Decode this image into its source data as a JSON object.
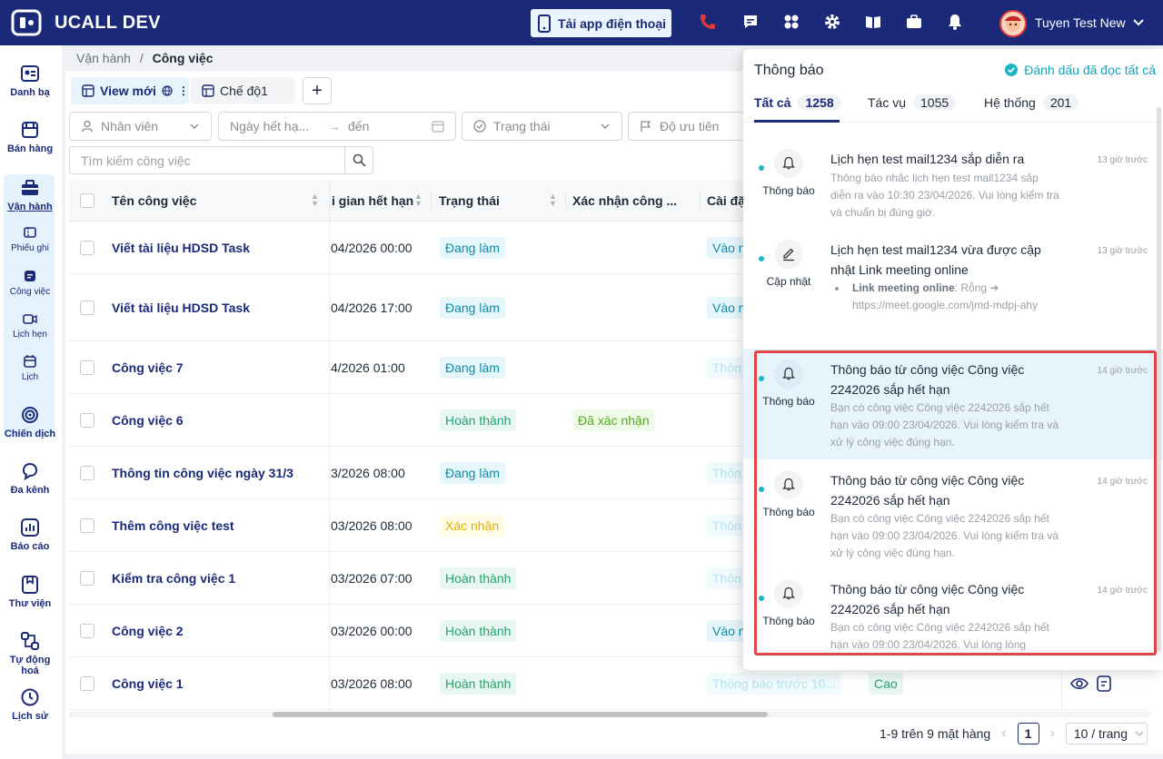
{
  "topbar": {
    "brand": "UCALL DEV",
    "app_button_label": "Tải app điện thoại",
    "user_name": "Tuyen Test New",
    "icons": [
      "phone-icon",
      "chat-icon",
      "apps-icon",
      "gear-icon",
      "book-icon",
      "briefcase-icon",
      "bell-icon"
    ]
  },
  "sidebar": {
    "items": [
      {
        "label": "Danh bạ",
        "icon": "contacts-icon"
      },
      {
        "label": "Bán hàng",
        "icon": "store-icon"
      },
      {
        "label": "Vận hành",
        "icon": "briefcase-icon"
      },
      {
        "label": "Phiếu ghi",
        "icon": "ticket-icon"
      },
      {
        "label": "Công việc",
        "icon": "task-icon"
      },
      {
        "label": "Lịch hẹn",
        "icon": "video-icon"
      },
      {
        "label": "Lịch",
        "icon": "calendar-icon"
      },
      {
        "label": "Chiến dịch",
        "icon": "target-icon"
      },
      {
        "label": "Đa kênh",
        "icon": "omnichannel-icon"
      },
      {
        "label": "Báo cáo",
        "icon": "chart-icon"
      },
      {
        "label": "Thư viện",
        "icon": "library-icon"
      },
      {
        "label": "Tự động hoá",
        "icon": "automation-icon"
      },
      {
        "label": "Lịch sử",
        "icon": "history-icon"
      }
    ]
  },
  "breadcrumb": {
    "parent": "Vận hành",
    "separator": "/",
    "current": "Công việc"
  },
  "views": {
    "view1": "View mới",
    "view2": "Chế độ1",
    "add": "+"
  },
  "filters": {
    "employee": "Nhân viên",
    "due_from": "Ngày hết hạ...",
    "arrow": "→",
    "due_to": "đến",
    "status": "Trạng thái",
    "priority": "Độ ưu tiên"
  },
  "search": {
    "placeholder": "Tìm kiếm công việc"
  },
  "table": {
    "columns": {
      "name": "Tên công việc",
      "due": "i gian hết hạn",
      "status": "Trạng thái",
      "confirm": "Xác nhận công ...",
      "setting": "Cài đặ"
    },
    "rows": [
      {
        "name": "Viết tài liệu HDSD Task",
        "due": "04/2026 00:00",
        "status": "Đang làm",
        "confirm": "",
        "remind": "Vào n"
      },
      {
        "name": "Viết tài liệu HDSD Task",
        "due": "04/2026 17:00",
        "status": "Đang làm",
        "confirm": "",
        "remind": "Vào n"
      },
      {
        "name": "Công việc 7",
        "due": "4/2026 01:00",
        "status": "Đang làm",
        "confirm": "",
        "remind": "Thôn"
      },
      {
        "name": "Công việc 6",
        "due": "",
        "status": "Hoàn thành",
        "confirm": "Đã xác nhận",
        "remind": ""
      },
      {
        "name": "Thông tin công việc ngày 31/3",
        "due": "3/2026 08:00",
        "status": "Đang làm",
        "confirm": "",
        "remind": "Thôn"
      },
      {
        "name": "Thêm công việc test",
        "due": "03/2026 08:00",
        "status": "Xác nhận",
        "confirm": "",
        "remind": "Thôn"
      },
      {
        "name": "Kiểm tra công việc 1",
        "due": "03/2026 07:00",
        "status": "Hoàn thành",
        "confirm": "",
        "remind": "Thôn"
      },
      {
        "name": "Công việc 2",
        "due": "03/2026 00:00",
        "status": "Hoàn thành",
        "confirm": "",
        "remind": "Vào n"
      },
      {
        "name": "Công việc 1",
        "due": "03/2026 08:00",
        "status": "Hoàn thành",
        "confirm": "",
        "remind": "Thông báo trước 10...",
        "priority": "Cao"
      }
    ]
  },
  "pagination": {
    "summary": "1-9 trên 9 mặt hàng",
    "prev": "‹",
    "page": "1",
    "next": "›",
    "page_size": "10 / trang"
  },
  "notifications": {
    "title": "Thông báo",
    "mark_all": "Đánh dấu đã đọc tất cả",
    "tabs": [
      {
        "label": "Tất cả",
        "count": "1258"
      },
      {
        "label": "Tác vụ",
        "count": "1055"
      },
      {
        "label": "Hệ thống",
        "count": "201"
      }
    ],
    "items": [
      {
        "type": "Thông báo",
        "icon": "bell-icon",
        "title": "Lịch hẹn test mail1234 sắp diễn ra",
        "body": "Thông báo nhắc lịch hẹn test mail1234 sắp diễn ra vào 10:30 23/04/2026. Vui lòng kiểm tra và chuẩn bị đúng giờ.",
        "time": "13 giờ trước"
      },
      {
        "type": "Cập nhật",
        "icon": "pencil-icon",
        "title": "Lịch hẹn test mail1234 vừa được cập nhật Link meeting online",
        "field": "Link meeting online",
        "detail": ": Rỗng ➜ https://meet.google.com/jmd-mdpj-ahy",
        "time": "13 giờ trước"
      },
      {
        "type": "Thông báo",
        "icon": "bell-icon",
        "title": "Thông báo từ công việc Công việc 2242026 sắp hết hạn",
        "body": "Bạn có công việc Công việc 2242026 sắp hết hạn vào 09:00 23/04/2026. Vui lòng kiểm tra và xử lý công việc đúng hạn.",
        "time": "14 giờ trước"
      },
      {
        "type": "Thông báo",
        "icon": "bell-icon",
        "title": "Thông báo từ công việc Công việc 2242026 sắp hết hạn",
        "body": "Bạn có công việc Công việc 2242026 sắp hết hạn vào 09:00 23/04/2026. Vui lòng kiểm tra và xử lý công việc đúng hạn.",
        "time": "14 giờ trước"
      },
      {
        "type": "Thông báo",
        "icon": "bell-icon",
        "title": "Thông báo từ công việc Công việc 2242026 sắp hết hạn",
        "body": "Bạn có công việc Công việc 2242026 sắp hết hạn vào 09:00 23/04/2026. Vui lòng lòng",
        "time": "14 giờ trước"
      }
    ]
  },
  "colors": {
    "brand": "#1a2a78",
    "accent": "#0ea5b7",
    "highlight": "#e0454a"
  }
}
